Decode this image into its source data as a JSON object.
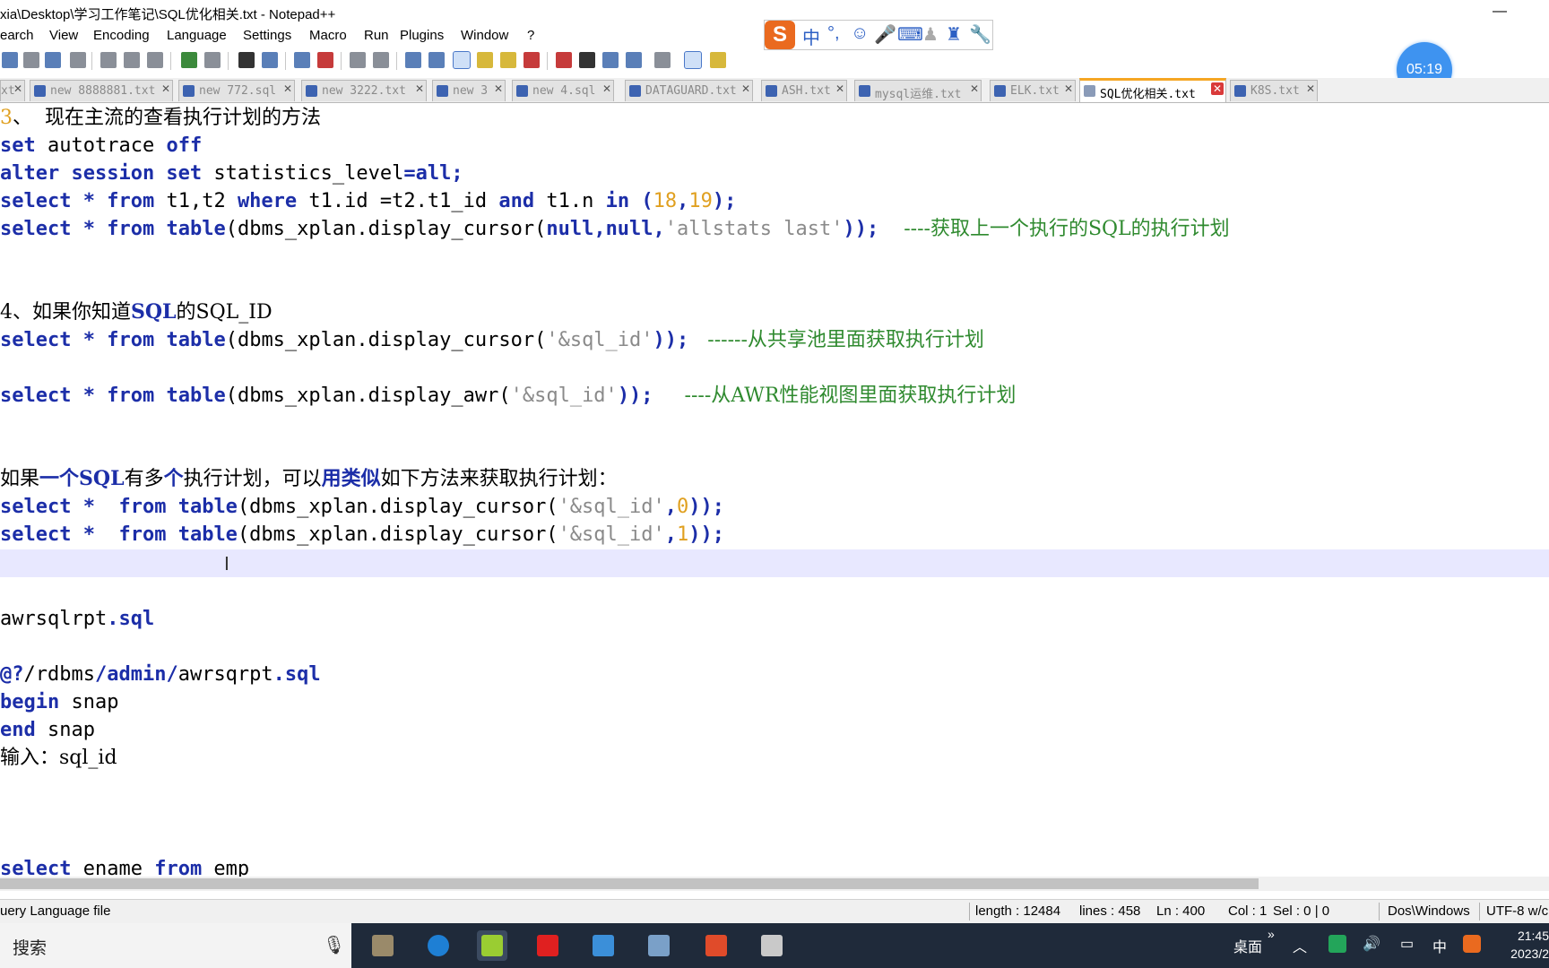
{
  "window": {
    "title": "xia\\Desktop\\学习工作笔记\\SQL优化相关.txt - Notepad++",
    "minimize": "—",
    "close": "✕"
  },
  "menu": [
    "earch",
    "View",
    "Encoding",
    "Language",
    "Settings",
    "Macro",
    "Run",
    "Plugins",
    "Window",
    "?"
  ],
  "ime": {
    "logo": "S",
    "mode": "中",
    "punct": "°,"
  },
  "timer": "05:19",
  "tabs": [
    {
      "label": "xt",
      "active": false
    },
    {
      "label": "new 8888881.txt",
      "active": false
    },
    {
      "label": "new 772.sql",
      "active": false
    },
    {
      "label": "new 3222.txt",
      "active": false
    },
    {
      "label": "new 3",
      "active": false
    },
    {
      "label": "new 4.sql",
      "active": false
    },
    {
      "label": "DATAGUARD.txt",
      "active": false
    },
    {
      "label": "ASH.txt",
      "active": false
    },
    {
      "label": "mysql运维.txt",
      "active": false
    },
    {
      "label": "ELK.txt",
      "active": false
    },
    {
      "label": "SQL优化相关.txt",
      "active": true
    },
    {
      "label": "K8S.txt",
      "active": false
    }
  ],
  "editor": {
    "l1_num": "3",
    "l1_text": "、  现在主流的查看执行计划的方法",
    "l2": [
      "set",
      " autotrace ",
      "off"
    ],
    "l3": [
      "alter session set",
      " statistics_level",
      "=",
      "all",
      ";"
    ],
    "l4": [
      "select",
      " * ",
      "from",
      " t1,t2 ",
      "where",
      " t1.id =t2.t1_id ",
      "and",
      " t1.n ",
      "in",
      " (",
      "18",
      ",",
      "19",
      ");"
    ],
    "l5": [
      "select",
      " * ",
      "from",
      " ",
      "table",
      "(dbms_xplan.display_cursor(",
      "null",
      ",",
      "null",
      ",",
      "'allstats last'",
      "));",
      "    ----获取上一个执行的SQL的执行计划"
    ],
    "l6": [
      "4、如果你知道",
      "SQL",
      "的SQL_ID"
    ],
    "l7": [
      "select",
      " * ",
      "from",
      " ",
      "table",
      "(dbms_xplan.display_cursor(",
      "'&sql_id'",
      "));",
      "   ------从共享池里面获取执行计划"
    ],
    "l8": [
      "select",
      " * ",
      "from",
      " ",
      "table",
      "(dbms_xplan.display_awr(",
      "'&sql_id'",
      "));",
      "     ----从AWR性能视图里面获取执行计划"
    ],
    "l9": [
      "如果",
      "一个",
      "SQL",
      "有多",
      "个",
      "执行计划，可以",
      "用类似",
      "如下方法来获取执行计划："
    ],
    "l10": [
      "select",
      " *  ",
      "from",
      " ",
      "table",
      "(dbms_xplan.display_cursor(",
      "'&sql_id'",
      ",",
      "0",
      "));"
    ],
    "l11": [
      "select",
      " *  ",
      "from",
      " ",
      "table",
      "(dbms_xplan.display_cursor(",
      "'&sql_id'",
      ",",
      "1",
      "));"
    ],
    "l12": [
      "awrsqlrpt",
      ".",
      "sql"
    ],
    "l13": [
      "@",
      "?",
      "/rdbms",
      "/admin/",
      "awrsqrpt",
      ".",
      "sql"
    ],
    "l14": [
      "begin",
      " snap"
    ],
    "l15": [
      "end",
      " snap"
    ],
    "l16": "输入：sql_id",
    "l17": [
      "select",
      " ename ",
      "from",
      " emp"
    ]
  },
  "status": {
    "filetype": "uery Language file",
    "length": "length : 12484",
    "lines": "lines : 458",
    "ln": "Ln : 400",
    "col": "Col : 1",
    "sel": "Sel : 0 | 0",
    "eol": "Dos\\Windows",
    "enc": "UTF-8 w/c"
  },
  "taskbar": {
    "search": "搜索",
    "desktop": "桌面",
    "chevron": "»",
    "ime": "中",
    "time": "21:45",
    "date": "2023/2"
  },
  "colors": {
    "keyword": "#1c2ea8",
    "comment": "#2f8a2f",
    "string": "#8a8a8a",
    "number": "#e0a020",
    "current_line": "#e8e8ff",
    "active_tab_accent": "#f5a623"
  }
}
